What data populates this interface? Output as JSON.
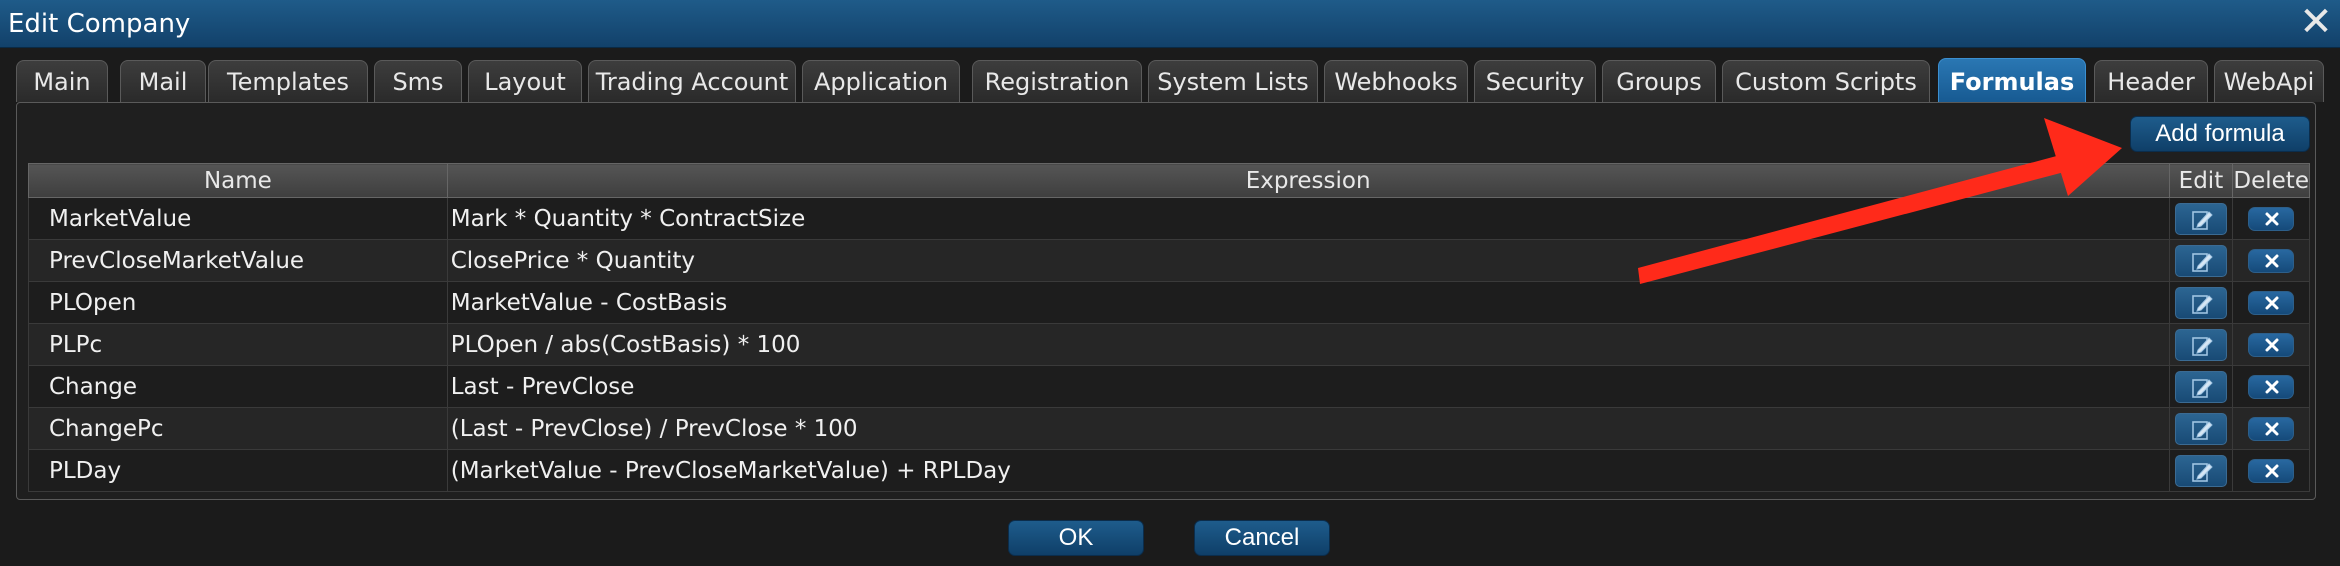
{
  "window": {
    "title": "Edit Company"
  },
  "tabs": [
    {
      "label": "Main",
      "active": false
    },
    {
      "label": "Mail",
      "active": false
    },
    {
      "label": "Templates",
      "active": false
    },
    {
      "label": "Sms",
      "active": false
    },
    {
      "label": "Layout",
      "active": false
    },
    {
      "label": "Trading Account",
      "active": false
    },
    {
      "label": "Application",
      "active": false
    },
    {
      "label": "Registration",
      "active": false
    },
    {
      "label": "System Lists",
      "active": false
    },
    {
      "label": "Webhooks",
      "active": false
    },
    {
      "label": "Security",
      "active": false
    },
    {
      "label": "Groups",
      "active": false
    },
    {
      "label": "Custom Scripts",
      "active": false
    },
    {
      "label": "Formulas",
      "active": true
    },
    {
      "label": "Header",
      "active": false
    },
    {
      "label": "WebApi",
      "active": false
    }
  ],
  "formulas": {
    "add_label": "Add formula",
    "columns": {
      "name": "Name",
      "expression": "Expression",
      "edit": "Edit",
      "delete": "Delete"
    },
    "rows": [
      {
        "name": "MarketValue",
        "expression": "Mark * Quantity * ContractSize"
      },
      {
        "name": "PrevCloseMarketValue",
        "expression": "ClosePrice * Quantity"
      },
      {
        "name": "PLOpen",
        "expression": "MarketValue - CostBasis"
      },
      {
        "name": "PLPc",
        "expression": "PLOpen / abs(CostBasis) * 100"
      },
      {
        "name": "Change",
        "expression": "Last - PrevClose"
      },
      {
        "name": "ChangePc",
        "expression": "(Last - PrevClose) / PrevClose * 100"
      },
      {
        "name": "PLDay",
        "expression": "(MarketValue - PrevCloseMarketValue) + RPLDay"
      }
    ]
  },
  "footer": {
    "ok_label": "OK",
    "cancel_label": "Cancel"
  },
  "icons": {
    "close": "close-icon",
    "edit": "edit-pencil-icon",
    "delete": "x-icon",
    "annotation": "red-arrow"
  },
  "colors": {
    "accent": "#175a92",
    "annotation": "#ff2a1a",
    "background": "#1b1b1b"
  }
}
